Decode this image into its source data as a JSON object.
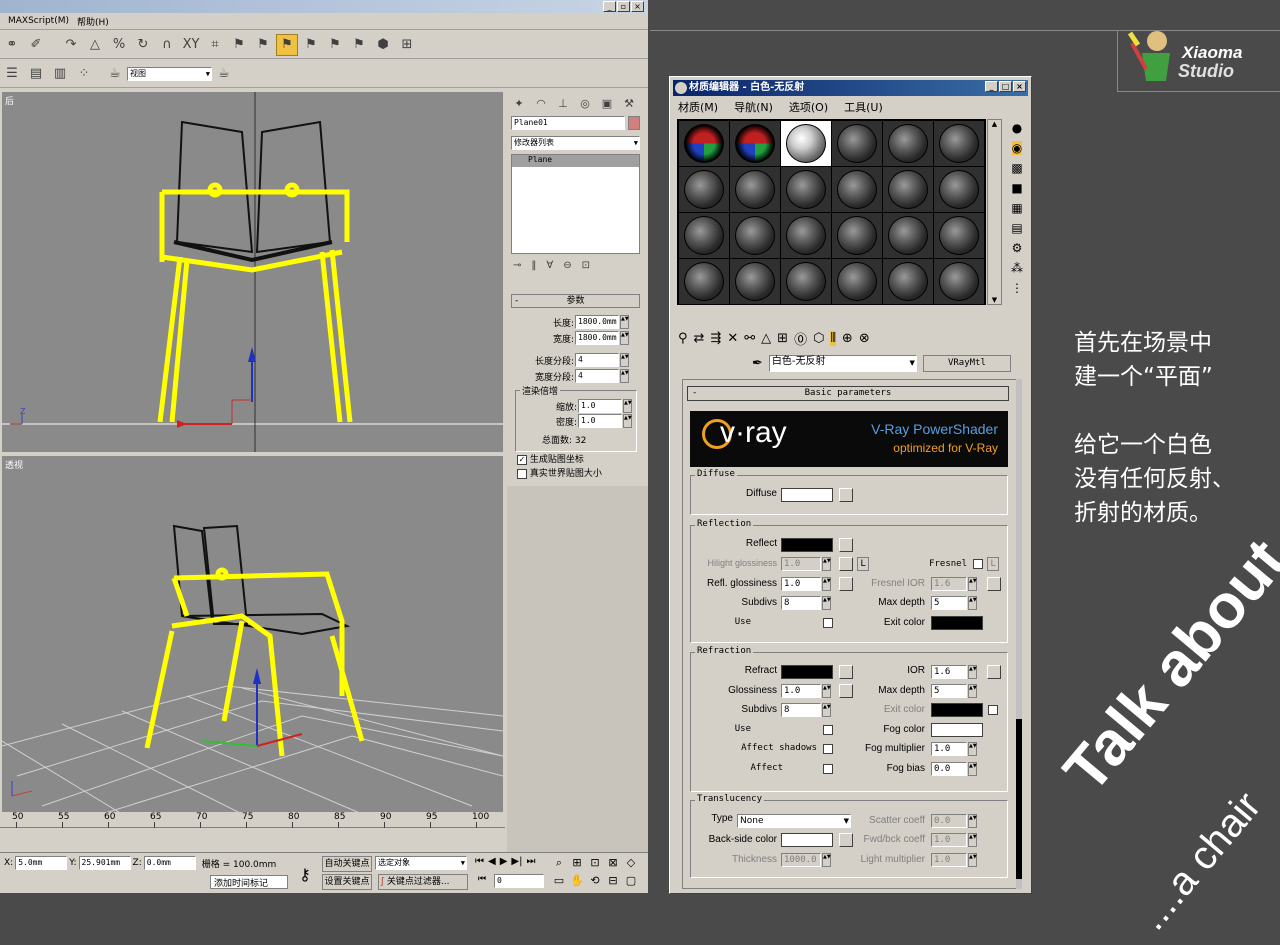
{
  "menubar": {
    "items": [
      "MAXScript(M)",
      "帮助(H)"
    ]
  },
  "toolbar2": {
    "view_select": "视图"
  },
  "viewports": {
    "back_label": "后",
    "persp_label": "透视"
  },
  "cmd": {
    "object_name": "Plane01",
    "modifier_list": "修改器列表",
    "stack_item": "Plane",
    "params_title": "参数",
    "length_label": "长度:",
    "length_val": "1800.0mm",
    "width_label": "宽度:",
    "width_val": "1800.0mm",
    "lseg_label": "长度分段:",
    "lseg_val": "4",
    "wseg_label": "宽度分段:",
    "wseg_val": "4",
    "render_mult": "渲染倍增",
    "scale_label": "缩放:",
    "scale_val": "1.0",
    "density_label": "密度:",
    "density_val": "1.0",
    "total_faces": "总面数: 32",
    "gen_map": "生成贴图坐标",
    "real_world": "真实世界贴图大小"
  },
  "timeline": {
    "ticks": [
      "50",
      "55",
      "60",
      "65",
      "70",
      "75",
      "80",
      "85",
      "90",
      "95",
      "100"
    ]
  },
  "status": {
    "x_label": "X:",
    "x_val": "5.0mm",
    "y_label": "Y:",
    "y_val": "25.901mm",
    "z_label": "Z:",
    "z_val": "0.0mm",
    "grid": "栅格 = 100.0mm",
    "auto_key": "自动关键点",
    "selected": "选定对象",
    "add_time_tag": "添加时间标记",
    "set_key": "设置关键点",
    "key_filter": "关键点过滤器...",
    "frame": "0"
  },
  "mated": {
    "title": "材质编辑器 - 白色-无反射",
    "menu": [
      "材质(M)",
      "导航(N)",
      "选项(O)",
      "工具(U)"
    ],
    "material_name": "白色-无反射",
    "material_type": "VRayMtl",
    "basic_params": "Basic parameters",
    "vray_logo": "v·ray",
    "powershader": "V-Ray PowerShader",
    "optimized": "optimized for V-Ray",
    "diffuse": {
      "title": "Diffuse",
      "label": "Diffuse"
    },
    "reflection": {
      "title": "Reflection",
      "reflect": "Reflect",
      "hilight": "Hilight glossiness",
      "hilight_val": "1.0",
      "L": "L",
      "fresnel": "Fresnel",
      "refl_gloss": "Refl. glossiness",
      "refl_gloss_val": "1.0",
      "fresnel_ior": "Fresnel IOR",
      "fresnel_ior_val": "1.6",
      "subdivs": "Subdivs",
      "subdivs_val": "8",
      "max_depth": "Max depth",
      "max_depth_val": "5",
      "use": "Use",
      "exit_color": "Exit color"
    },
    "refraction": {
      "title": "Refraction",
      "refract": "Refract",
      "ior": "IOR",
      "ior_val": "1.6",
      "glossiness": "Glossiness",
      "gloss_val": "1.0",
      "max_depth": "Max depth",
      "max_depth_val": "5",
      "subdivs": "Subdivs",
      "subdivs_val": "8",
      "exit_color": "Exit color",
      "use": "Use",
      "fog_color": "Fog color",
      "affect_shadows": "Affect shadows",
      "fog_mult": "Fog multiplier",
      "fog_mult_val": "1.0",
      "affect": "Affect",
      "fog_bias": "Fog bias",
      "fog_bias_val": "0.0"
    },
    "translucency": {
      "title": "Translucency",
      "type": "Type",
      "type_val": "None",
      "scatter": "Scatter coeff",
      "scatter_val": "0.0",
      "backside": "Back-side color",
      "fwd": "Fwd/bck coeff",
      "fwd_val": "1.0",
      "thickness": "Thickness",
      "thickness_val": "1000.0",
      "light_mult": "Light multiplier",
      "light_mult_val": "1.0"
    }
  },
  "caption": {
    "line1": "首先在场景中",
    "line2": "建一个“平面”",
    "line3": "给它一个白色",
    "line4": "没有任何反射、",
    "line5": "折射的材质。"
  },
  "logo": {
    "line1": "Xiaoma",
    "line2": "Studio"
  },
  "watermark": {
    "line1": "Talk about",
    "line2": "....a chair"
  },
  "colors": {
    "selection": "#ffff00",
    "vray_blue": "#5a9ee0",
    "vray_orange": "#f0a020"
  }
}
